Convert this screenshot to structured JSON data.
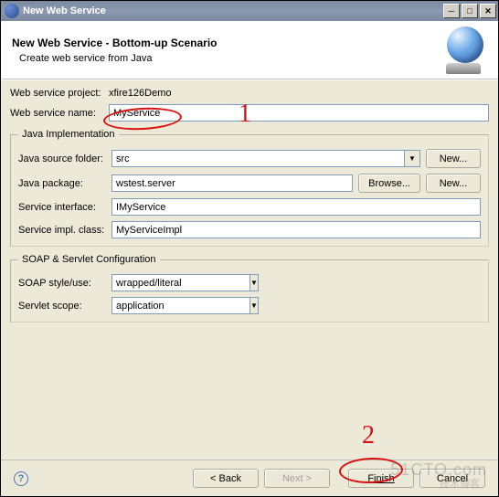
{
  "window": {
    "title": "New Web Service"
  },
  "header": {
    "title": "New Web Service - Bottom-up Scenario",
    "subtitle": "Create web service from Java"
  },
  "top_form": {
    "project_label": "Web service project:",
    "project_value": "xfire126Demo",
    "name_label": "Web service name:",
    "name_value": "MyService"
  },
  "java_impl": {
    "legend": "Java Implementation",
    "source_label": "Java source folder:",
    "source_value": "src",
    "source_new_btn": "New...",
    "package_label": "Java package:",
    "package_value": "wstest.server",
    "package_browse_btn": "Browse...",
    "package_new_btn": "New...",
    "interface_label": "Service interface:",
    "interface_value": "IMyService",
    "impl_label": "Service impl. class:",
    "impl_value": "MyServiceImpl"
  },
  "soap": {
    "legend": "SOAP & Servlet Configuration",
    "style_label": "SOAP style/use:",
    "style_value": "wrapped/literal",
    "scope_label": "Servlet scope:",
    "scope_value": "application"
  },
  "footer": {
    "back": "< Back",
    "next": "Next >",
    "finish": "Finish",
    "cancel": "Cancel"
  },
  "annotations": {
    "mark1": "1",
    "mark2": "2"
  },
  "watermark": {
    "line1": "51CTO.com",
    "line2": "技术博客"
  }
}
